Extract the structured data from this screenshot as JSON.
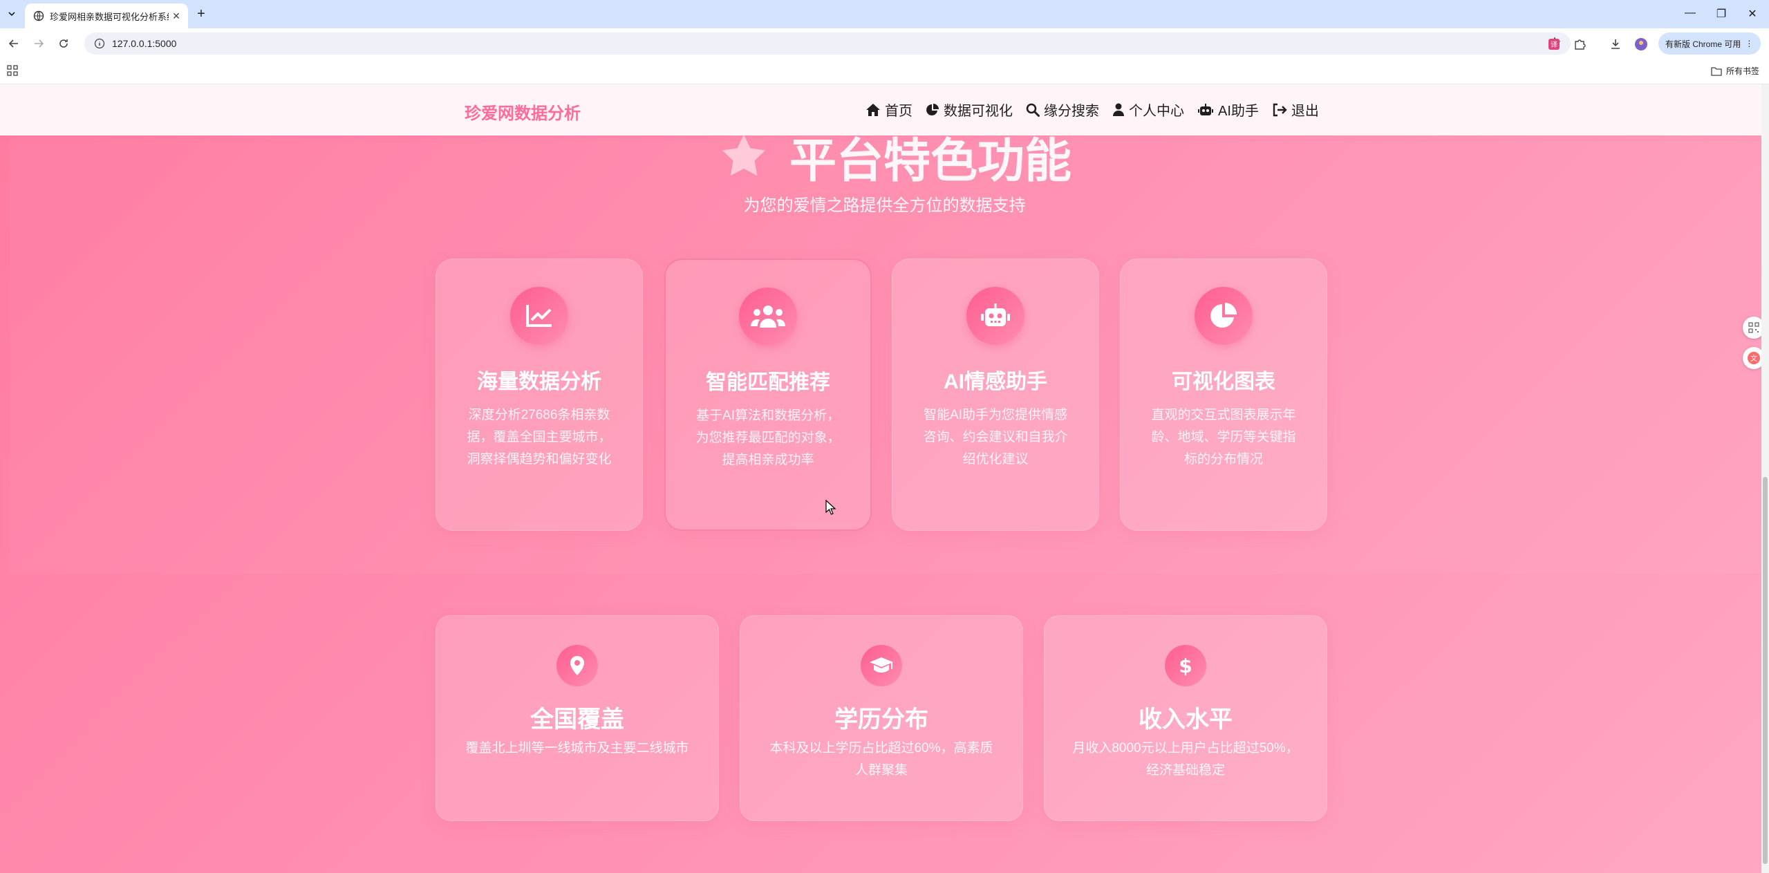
{
  "browser": {
    "tab_title": "珍爱网相亲数据可视化分析系统",
    "tab_close": "✕",
    "new_tab": "+",
    "url": "127.0.0.1:5000",
    "update_label": "有新版 Chrome 可用",
    "bookmarks_folder": "所有书签"
  },
  "navbar": {
    "brand": "珍爱网数据分析",
    "links": [
      {
        "label": "首页",
        "icon": "home-icon"
      },
      {
        "label": "数据可视化",
        "icon": "chart-pie-icon"
      },
      {
        "label": "缘分搜索",
        "icon": "search-icon"
      },
      {
        "label": "个人中心",
        "icon": "user-icon"
      },
      {
        "label": "AI助手",
        "icon": "robot-icon"
      },
      {
        "label": "退出",
        "icon": "sign-out-icon"
      }
    ]
  },
  "hero": {
    "title": "平台特色功能",
    "subtitle": "为您的爱情之路提供全方位的数据支持"
  },
  "features": [
    {
      "title": "海量数据分析",
      "desc": "深度分析27686条相亲数据，覆盖全国主要城市，洞察择偶趋势和偏好变化",
      "icon": "chart-line-icon"
    },
    {
      "title": "智能匹配推荐",
      "desc": "基于AI算法和数据分析，为您推荐最匹配的对象，提高相亲成功率",
      "icon": "users-icon"
    },
    {
      "title": "AI情感助手",
      "desc": "智能AI助手为您提供情感咨询、约会建议和自我介绍优化建议",
      "icon": "robot-icon"
    },
    {
      "title": "可视化图表",
      "desc": "直观的交互式图表展示年龄、地域、学历等关键指标的分布情况",
      "icon": "chart-pie-icon"
    }
  ],
  "stats": [
    {
      "title": "全国覆盖",
      "desc": "覆盖北上圳等一线城市及主要二线城市",
      "icon": "map-marker-icon"
    },
    {
      "title": "学历分布",
      "desc": "本科及以上学历占比超过60%，高素质人群聚集",
      "icon": "graduation-cap-icon"
    },
    {
      "title": "收入水平",
      "desc": "月收入8000元以上用户占比超过50%，经济基础稳定",
      "icon": "dollar-icon"
    }
  ],
  "colors": {
    "brand": "#ff6b9a",
    "accent": "#ff5d8f",
    "page_bg": "#ff8eb0"
  }
}
